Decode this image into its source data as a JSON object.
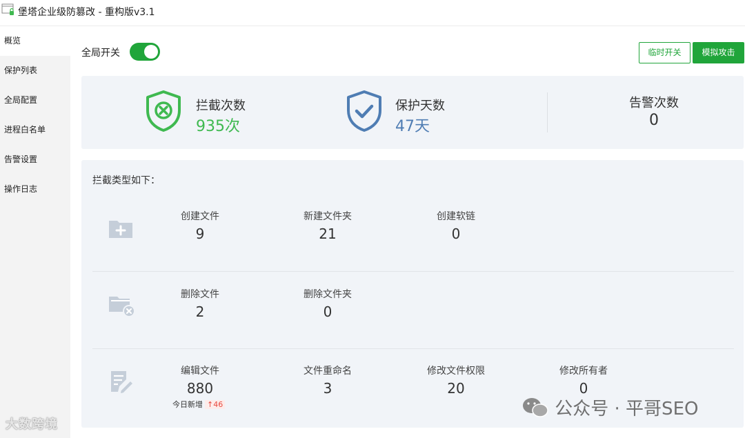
{
  "window": {
    "title": "堡塔企业级防篡改 - 重构版v3.1"
  },
  "sidebar": {
    "items": [
      {
        "label": "概览",
        "active": true
      },
      {
        "label": "保护列表"
      },
      {
        "label": "全局配置"
      },
      {
        "label": "进程白名单"
      },
      {
        "label": "告警设置"
      },
      {
        "label": "操作日志"
      }
    ]
  },
  "header": {
    "global_switch_label": "全局开关",
    "global_switch_on": true,
    "temp_switch_label": "临时开关",
    "simulate_attack_label": "模拟攻击"
  },
  "stats": {
    "intercepts": {
      "label": "拦截次数",
      "value": "935次",
      "color": "#3fb950",
      "icon": "shield-x-icon"
    },
    "protect_days": {
      "label": "保护天数",
      "value": "47天",
      "color": "#4f7db3",
      "icon": "shield-check-icon"
    },
    "alerts": {
      "label": "告警次数",
      "value": "0"
    }
  },
  "types": {
    "heading": "拦截类型如下：",
    "create": {
      "icon": "folder-plus-icon",
      "items": [
        {
          "label": "创建文件",
          "value": "9"
        },
        {
          "label": "新建文件夹",
          "value": "21"
        },
        {
          "label": "创建软链",
          "value": "0"
        }
      ]
    },
    "delete": {
      "icon": "folder-delete-icon",
      "items": [
        {
          "label": "删除文件",
          "value": "2"
        },
        {
          "label": "删除文件夹",
          "value": "0"
        }
      ]
    },
    "modify": {
      "icon": "edit-file-icon",
      "items": [
        {
          "label": "编辑文件",
          "value": "880"
        },
        {
          "label": "文件重命名",
          "value": "3"
        },
        {
          "label": "修改文件权限",
          "value": "20"
        },
        {
          "label": "修改所有者",
          "value": "0"
        }
      ],
      "today_label": "今日新增",
      "today_delta": "↑46"
    }
  },
  "watermarks": {
    "left": "大数跨境",
    "right": "公众号 · 平哥SEO"
  },
  "colors": {
    "accent": "#20a53a",
    "card_bg": "#f1f4f8",
    "icon_gray": "#c5ced9"
  }
}
